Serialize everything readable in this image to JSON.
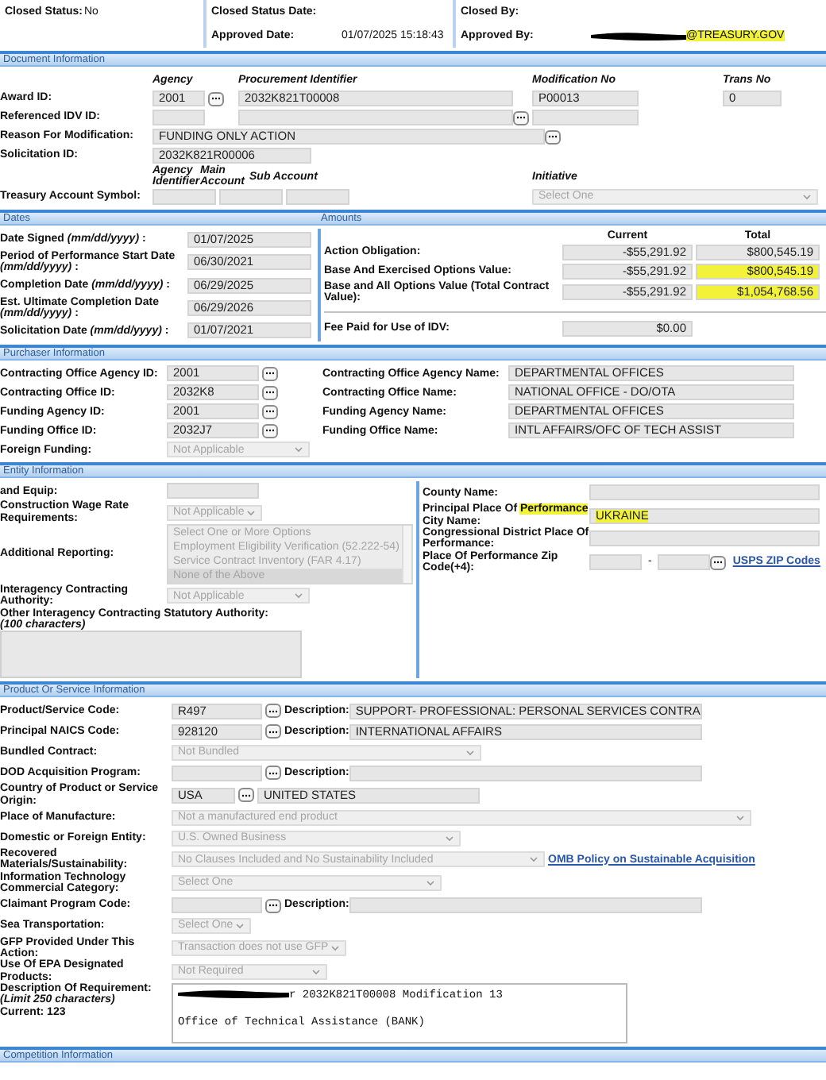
{
  "header": {
    "closed_status": {
      "label": "Closed Status:",
      "value": "No"
    },
    "closed_status_date": {
      "label": "Closed Status Date:"
    },
    "closed_by": {
      "label": "Closed By:"
    },
    "approved_date": {
      "label": "Approved Date:",
      "value": "01/07/2025 15:18:43"
    },
    "approved_by": {
      "label": "Approved By:",
      "value": "@TREASURY.GOV",
      "redacted": true,
      "highlighted": true
    }
  },
  "document_information": {
    "title": "Document Information",
    "column_headings": [
      "Agency",
      "Procurement Identifier",
      "Modification No",
      "Trans No"
    ],
    "award_id": {
      "label": "Award ID:",
      "agency": "2001",
      "procurement_identifier": "2032K821T00008",
      "modification_no": "P00013",
      "trans_no": "0"
    },
    "referenced_idv_id": {
      "label": "Referenced IDV ID:"
    },
    "reason_for_modification": {
      "label": "Reason For Modification:",
      "value": "FUNDING ONLY ACTION"
    },
    "solicitation_id": {
      "label": "Solicitation ID:",
      "value": "2032K821R00006"
    },
    "tas_headings": [
      "Agency Identifier",
      "Main Account",
      "Sub Account"
    ],
    "treasury_account_symbol": {
      "label": "Treasury Account Symbol:"
    },
    "initiative": {
      "label": "Initiative",
      "value": "Select One"
    }
  },
  "dates": {
    "title": "Dates",
    "rows": [
      {
        "label": "Date Signed *(mm/dd/yyyy)* :",
        "value": "01/07/2025"
      },
      {
        "label": "Period of Performance Start Date *(mm/dd/yyyy)* :",
        "value": "06/30/2021"
      },
      {
        "label": "Completion Date *(mm/dd/yyyy)* :",
        "value": "06/29/2025"
      },
      {
        "label": "Est. Ultimate Completion Date *(mm/dd/yyyy)* :",
        "value": "06/29/2026"
      },
      {
        "label": "Solicitation Date *(mm/dd/yyyy)* :",
        "value": "01/07/2021"
      }
    ]
  },
  "amounts": {
    "title": "Amounts",
    "columns": [
      "Current",
      "Total"
    ],
    "rows": [
      {
        "label": "Action Obligation:",
        "current": "-$55,291.92",
        "total": "$800,545.19",
        "highlighted": false
      },
      {
        "label": "Base And Exercised Options Value:",
        "current": "-$55,291.92",
        "total": "$800,545.19",
        "highlighted": true
      },
      {
        "label": "Base and All Options Value (Total Contract Value):",
        "current": "-$55,291.92",
        "total": "$1,054,768.56",
        "highlighted": true
      }
    ],
    "fee": {
      "label": "Fee Paid for Use of IDV:",
      "value": "$0.00"
    }
  },
  "purchaser_information": {
    "title": "Purchaser Information",
    "rows": [
      {
        "id_label": "Contracting Office Agency ID:",
        "id": "2001",
        "name_label": "Contracting Office Agency Name:",
        "name": "DEPARTMENTAL OFFICES"
      },
      {
        "id_label": "Contracting Office ID:",
        "id": "2032K8",
        "name_label": "Contracting Office Name:",
        "name": "NATIONAL OFFICE - DO/OTA"
      },
      {
        "id_label": "Funding Agency ID:",
        "id": "2001",
        "name_label": "Funding Agency Name:",
        "name": "DEPARTMENTAL OFFICES"
      },
      {
        "id_label": "Funding Office ID:",
        "id": "2032J7",
        "name_label": "Funding Office Name:",
        "name": "INTL AFFAIRS/OFC OF TECH ASSIST"
      }
    ],
    "foreign_funding": {
      "label": "Foreign Funding:",
      "value": "Not Applicable"
    }
  },
  "entity_information": {
    "title": "Entity Information",
    "left": [
      {
        "kind": "box",
        "label": "and Equip:"
      },
      {
        "kind": "select",
        "label": "Construction Wage Rate Requirements:",
        "value": "Not Applicable"
      },
      {
        "kind": "listbox",
        "label": "Additional Reporting:",
        "options": [
          {
            "text": "Select One or More Options",
            "selected": false
          },
          {
            "text": "Employment Eligibility Verification (52.222-54)",
            "selected": false
          },
          {
            "text": "Service Contract Inventory (FAR 4.17)",
            "selected": false
          },
          {
            "text": "None of the Above",
            "selected": true
          }
        ]
      },
      {
        "kind": "select",
        "label": "Interagency Contracting Authority:",
        "value": "Not Applicable"
      },
      {
        "kind": "textarea",
        "label": "Other Interagency Contracting Statutory Authority:",
        "hint": "(100 characters)"
      }
    ],
    "right": [
      {
        "kind": "box",
        "label_parts": [
          {
            "text": "County Name:",
            "highlighted": false
          }
        ]
      },
      {
        "kind": "box",
        "label_parts": [
          {
            "text": "Principal Place Of ",
            "highlighted": false
          },
          {
            "text": "Performance",
            "highlighted": true
          },
          {
            "text": " City Name:",
            "highlighted": false
          }
        ],
        "value": "UKRAINE",
        "highlighted": true
      },
      {
        "kind": "box",
        "label_parts": [
          {
            "text": "Congressional District Place Of Performance:",
            "highlighted": false
          }
        ]
      },
      {
        "kind": "zip",
        "label_parts": [
          {
            "text": "Place Of Performance Zip Code(+4):",
            "highlighted": false
          }
        ],
        "separator": "-",
        "link": "USPS ZIP Codes"
      }
    ]
  },
  "product_or_service_information": {
    "title": "Product Or Service Information",
    "rows": [
      {
        "kind": "lookup",
        "label": "Product/Service Code:",
        "code": "R497",
        "description_label": "Description:",
        "description": "SUPPORT- PROFESSIONAL: PERSONAL SERVICES CONTRA"
      },
      {
        "kind": "lookup",
        "label": "Principal NAICS Code:",
        "code": "928120",
        "description_label": "Description:",
        "description": "INTERNATIONAL AFFAIRS"
      },
      {
        "kind": "select",
        "label": "Bundled Contract:",
        "value": "Not Bundled"
      },
      {
        "kind": "lookup",
        "label": "DOD Acquisition Program:",
        "description_label": "Description:"
      },
      {
        "kind": "code_name",
        "label": "Country of Product or Service Origin:",
        "code": "USA",
        "name": "UNITED STATES"
      },
      {
        "kind": "select",
        "label": "Place of Manufacture:",
        "value": "Not a manufactured end product"
      },
      {
        "kind": "select",
        "label": "Domestic or Foreign Entity:",
        "value": "U.S. Owned Business"
      },
      {
        "kind": "select",
        "label": "Recovered Materials/Sustainability:",
        "value": "No Clauses Included and No Sustainability Included",
        "link": "OMB Policy on Sustainable Acquisition"
      },
      {
        "kind": "select",
        "label": "Information Technology Commercial Category:",
        "value": "Select One"
      },
      {
        "kind": "lookup",
        "label": "Claimant Program Code:",
        "description_label": "Description:"
      },
      {
        "kind": "select",
        "label": "Sea Transportation:",
        "value": "Select One"
      },
      {
        "kind": "select",
        "label": "GFP Provided Under This Action:",
        "value": "Transaction does not use GFP"
      },
      {
        "kind": "select",
        "label": "Use Of EPA Designated Products:",
        "value": "Not Required"
      },
      {
        "kind": "textarea",
        "label": "Description Of Requirement:",
        "hint": "(Limit 250 characters)",
        "counter": "Current: 123",
        "lines": [
          "r 2032K821T00008 Modification 13",
          "Office of Technical Assistance (BANK)"
        ],
        "redacted": true
      }
    ]
  },
  "competition_information": {
    "title": "Competition Information"
  }
}
